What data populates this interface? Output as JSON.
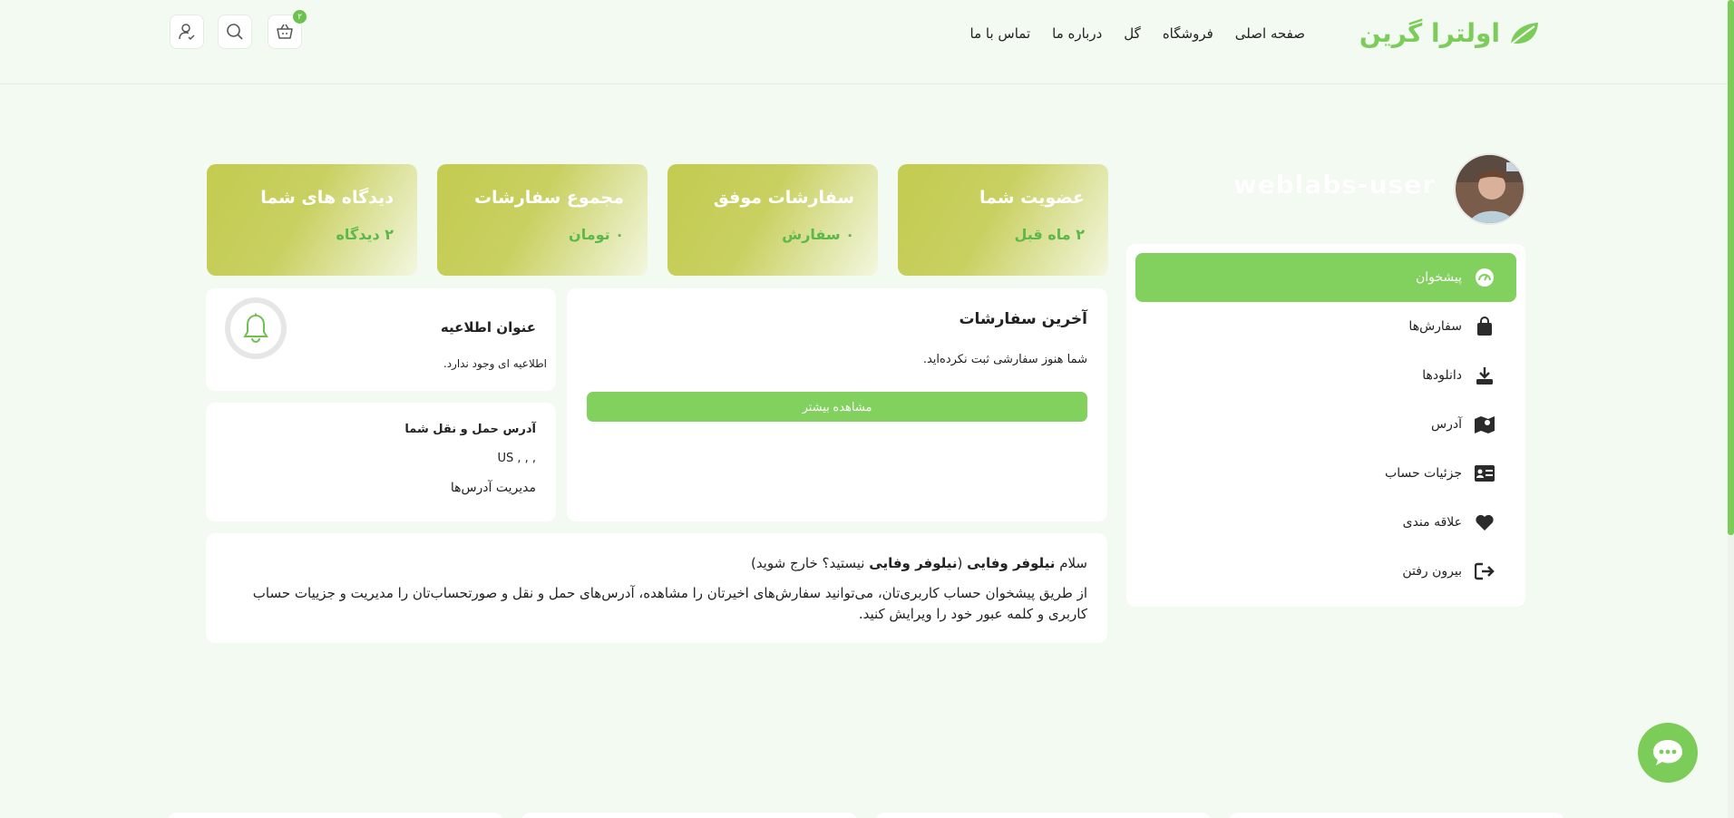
{
  "header": {
    "logo_text": "اولترا گرین",
    "nav": [
      "صفحه اصلی",
      "فروشگاه",
      "گل",
      "درباره ما",
      "تماس با ما"
    ],
    "cart_count": "۲",
    "icons": [
      "cart-icon",
      "search-icon",
      "user-check-icon"
    ]
  },
  "profile": {
    "username": "weblabs-user"
  },
  "sidebar": {
    "items": [
      {
        "label": "پیشخوان",
        "icon": "dashboard-icon",
        "active": true
      },
      {
        "label": "سفارش‌ها",
        "icon": "shopping-bag-icon",
        "active": false
      },
      {
        "label": "دانلودها",
        "icon": "download-icon",
        "active": false
      },
      {
        "label": "آدرس",
        "icon": "map-icon",
        "active": false
      },
      {
        "label": "جزئیات حساب",
        "icon": "id-card-icon",
        "active": false
      },
      {
        "label": "علاقه مندی",
        "icon": "heart-icon",
        "active": false
      },
      {
        "label": "بیرون رفتن",
        "icon": "logout-icon",
        "active": false
      }
    ],
    "active_color": "#82d15f"
  },
  "stats": [
    {
      "title": "عضویت شما",
      "value": "۲ ماه قبل"
    },
    {
      "title": "سفارشات موفق",
      "value": "۰ سفارش"
    },
    {
      "title": "مجموع سفارشات",
      "value": "۰ تومان"
    },
    {
      "title": "دیدگاه های شما",
      "value": "۲ دیدگاه"
    }
  ],
  "orders": {
    "title": "آخرین سفارشات",
    "empty_text": "شما هنوز سفارشی ثبت نکرده‌اید.",
    "more_button": "مشاهده بیشتر"
  },
  "notice": {
    "title": "عنوان اطلاعیه",
    "text": "اطلاعیه ای وجود ندارد."
  },
  "address": {
    "title": "آدرس حمل و نقل شما",
    "value": "US , , ,",
    "manage_link": "مدیریت آدرس‌ها"
  },
  "welcome": {
    "greeting_prefix": "سلام",
    "name": "نیلوفر وفایی",
    "paren_open": "(",
    "paren_name": "نیلوفر وفایی",
    "not_you": "نیستید؟",
    "logout": "خارج شوید",
    "paren_close": ")",
    "body": "از طریق پیشخوان حساب کاربری‌تان، می‌توانید سفارش‌های اخیرتان را مشاهده، آدرس‌های حمل و نقل و صورتحساب‌تان را مدیریت و جزییات حساب کاربری و کلمه عبور خود را ویرایش کنید."
  },
  "colors": {
    "brand": "#7ccc5a",
    "background": "#f3faf1",
    "stat_card": "#c6cd58"
  }
}
